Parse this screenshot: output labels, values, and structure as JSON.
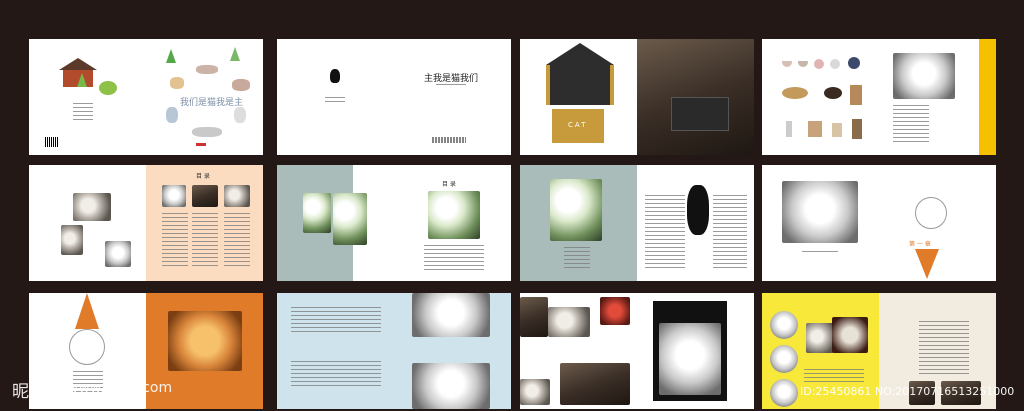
{
  "book": {
    "title_cn": "我们是猫我是主",
    "title_cn_mirror": "主我是猫我们",
    "spine_text": "我们是猫我是主",
    "cat_word": "CAT"
  },
  "sections": {
    "contents_label": "目  录",
    "intro_label": "目  录",
    "chapter_label": "第  一  章"
  },
  "colors": {
    "background": "#231815",
    "peach": "#fbdcc0",
    "teal": "#a9bcb9",
    "gold": "#f5c000",
    "orange": "#e07b2a",
    "light_blue": "#cfe3ec",
    "cream": "#f2ece0",
    "yellow": "#f7e83a",
    "black": "#111111"
  },
  "watermark": {
    "logo": "昵图网",
    "site": "www.nipic.com",
    "id": "ID:25450861 NO:20170716513251000"
  }
}
